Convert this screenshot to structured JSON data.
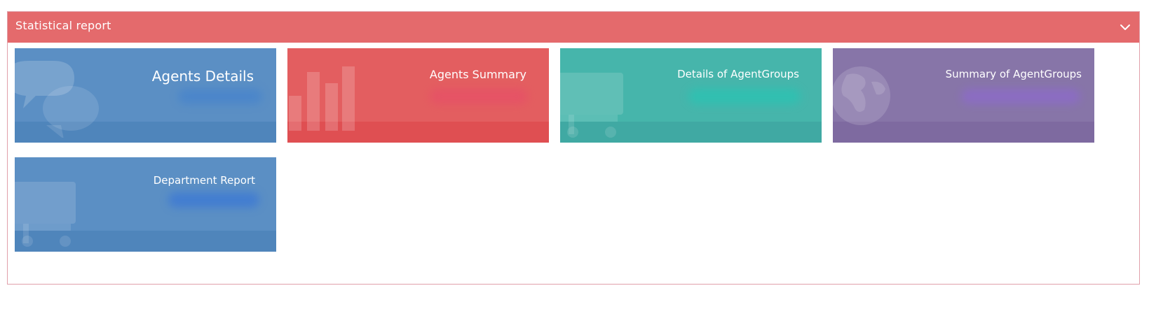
{
  "panel": {
    "title": "Statistical report",
    "header_color": "#e46a6c",
    "collapse_icon": "chevron-down-icon"
  },
  "tiles": [
    {
      "label": "Agents Details",
      "color": "#5b8fc4",
      "footer_color": "#4f85bb",
      "icon": "chat-bubbles-icon"
    },
    {
      "label": "Agents Summary",
      "color": "#e35e60",
      "footer_color": "#df4f52",
      "icon": "bar-chart-icon"
    },
    {
      "label": "Details of AgentGroups",
      "color": "#46b5ab",
      "footer_color": "#40a9a3",
      "icon": "cart-icon"
    },
    {
      "label": "Summary of AgentGroups",
      "color": "#8775a8",
      "footer_color": "#7e6aa0",
      "icon": "globe-icon"
    },
    {
      "label": "Department Report",
      "color": "#5b8fc4",
      "footer_color": "#4f85bb",
      "icon": "cart-icon"
    }
  ]
}
